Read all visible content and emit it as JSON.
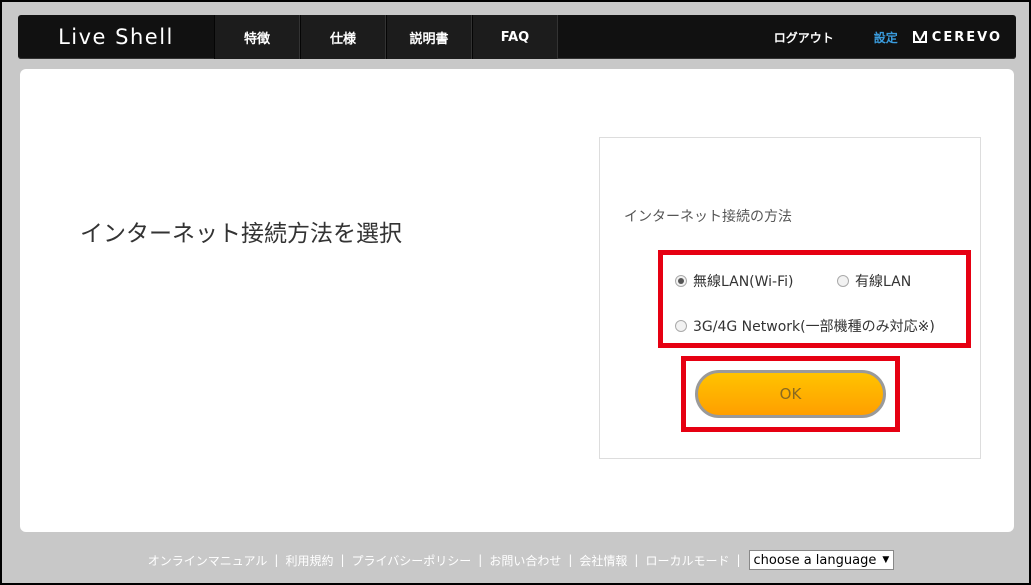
{
  "header": {
    "brand": "Live Shell",
    "nav": [
      "特徴",
      "仕様",
      "説明書",
      "FAQ"
    ],
    "logout": "ログアウト",
    "settings": "設定",
    "logo_text": "CEREVO",
    "accent_color": "#3a9bdc"
  },
  "main": {
    "title": "インターネット接続方法を選択",
    "panel_label": "インターネット接続の方法",
    "options": [
      {
        "label": "無線LAN(Wi-Fi)",
        "selected": true
      },
      {
        "label": "有線LAN",
        "selected": false
      },
      {
        "label": "3G/4G Network(一部機種のみ対応※)",
        "selected": false
      }
    ],
    "ok_label": "OK",
    "highlight_color": "#e60012"
  },
  "footer": {
    "links": [
      "オンラインマニュアル",
      "利用規約",
      "プライバシーポリシー",
      "お問い合わせ",
      "会社情報",
      "ローカルモード"
    ],
    "language_select": "choose a language"
  }
}
